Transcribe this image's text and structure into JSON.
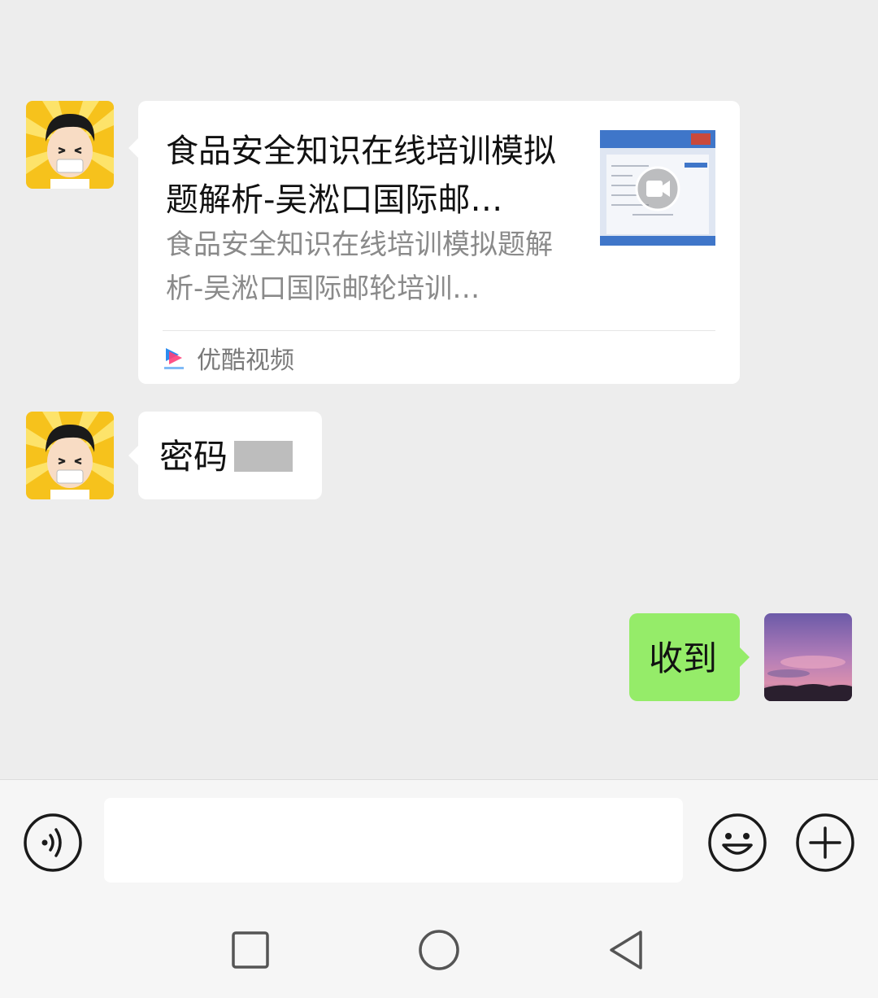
{
  "messages": {
    "link_card": {
      "title": "食品安全知识在线培训模拟题解析-吴淞口国际邮…",
      "description": "食品安全知识在线培训模拟题解析-吴淞口国际邮轮培训…",
      "source": "优酷视频",
      "source_icon": "youku-icon",
      "thumbnail_icon": "video-play-icon"
    },
    "password_message": {
      "text": "密码"
    },
    "outgoing_message": {
      "text": "收到"
    }
  },
  "input_bar": {
    "voice_icon": "voice-icon",
    "emoji_icon": "emoji-icon",
    "more_icon": "plus-icon",
    "input_value": ""
  },
  "nav_bar": {
    "recent_icon": "square-icon",
    "home_icon": "circle-icon",
    "back_icon": "triangle-back-icon"
  },
  "colors": {
    "background": "#ededed",
    "incoming_bubble": "#ffffff",
    "outgoing_bubble": "#95ec69"
  }
}
